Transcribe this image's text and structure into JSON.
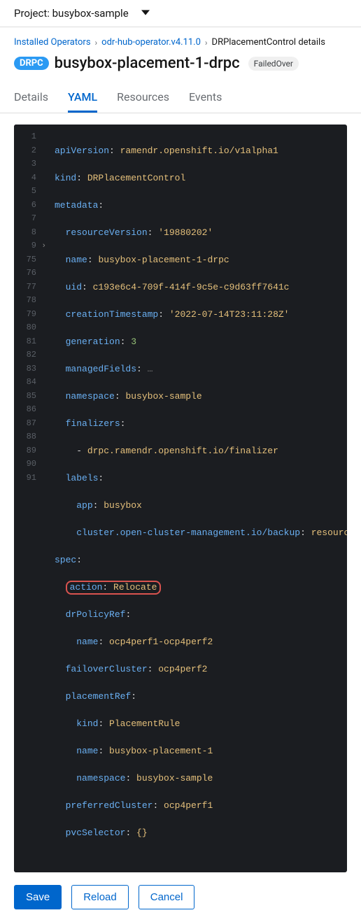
{
  "project": {
    "label": "Project:",
    "value": "busybox-sample"
  },
  "breadcrumbs": {
    "installed": "Installed Operators",
    "operator": "odr-hub-operator.v4.11.0",
    "current": "DRPlacementControl details"
  },
  "header": {
    "res_badge": "DRPC",
    "title": "busybox-placement-1-drpc",
    "status": "FailedOver"
  },
  "tabs": {
    "details": "Details",
    "yaml": "YAML",
    "resources": "Resources",
    "events": "Events"
  },
  "code": {
    "l1_k": "apiVersion",
    "l1_v": "ramendr.openshift.io/v1alpha1",
    "l2_k": "kind",
    "l2_v": "DRPlacementControl",
    "l3_k": "metadata",
    "l4_k": "resourceVersion",
    "l4_v": "'19880202'",
    "l5_k": "name",
    "l5_v": "busybox-placement-1-drpc",
    "l6_k": "uid",
    "l6_v": "c193e6c4-709f-414f-9c5e-c9d63ff7641c",
    "l7_k": "creationTimestamp",
    "l7_v": "'2022-07-14T23:11:28Z'",
    "l8_k": "generation",
    "l8_v": "3",
    "l9_k": "managedFields",
    "l75_k": "namespace",
    "l75_v": "busybox-sample",
    "l76_k": "finalizers",
    "l77_v": "drpc.ramendr.openshift.io/finalizer",
    "l78_k": "labels",
    "l79_k": "app",
    "l79_v": "busybox",
    "l80_k": "cluster.open-cluster-management.io/backup",
    "l80_v": "resource",
    "l81_k": "spec",
    "l82_k": "action",
    "l82_v": "Relocate",
    "l83_k": "drPolicyRef",
    "l84_k": "name",
    "l84_v": "ocp4perf1-ocp4perf2",
    "l85_k": "failoverCluster",
    "l85_v": "ocp4perf2",
    "l86_k": "placementRef",
    "l87_k": "kind",
    "l87_v": "PlacementRule",
    "l88_k": "name",
    "l88_v": "busybox-placement-1",
    "l89_k": "namespace",
    "l89_v": "busybox-sample",
    "l90_k": "preferredCluster",
    "l90_v": "ocp4perf1",
    "l91_k": "pvcSelector",
    "l91_v": "{}"
  },
  "line_numbers": [
    "1",
    "2",
    "3",
    "4",
    "5",
    "6",
    "7",
    "8",
    "9",
    "75",
    "76",
    "77",
    "78",
    "79",
    "80",
    "81",
    "82",
    "83",
    "84",
    "85",
    "86",
    "87",
    "88",
    "89",
    "90",
    "91"
  ],
  "footer": {
    "save": "Save",
    "reload": "Reload",
    "cancel": "Cancel"
  }
}
